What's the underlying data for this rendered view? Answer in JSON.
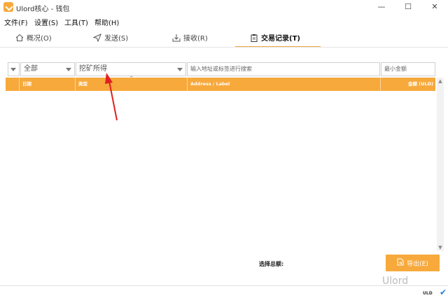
{
  "window": {
    "title": "Ulord核心 - 钱包",
    "controls": {
      "minimize": "—",
      "maximize": "☐",
      "close": "✕"
    }
  },
  "menu": [
    "文件(F)",
    "设置(S)",
    "工具(T)",
    "帮助(H)"
  ],
  "tabs": [
    {
      "label": "概况(O)",
      "icon": "home-icon",
      "active": false
    },
    {
      "label": "发送(S)",
      "icon": "send-icon",
      "active": false
    },
    {
      "label": "接收(R)",
      "icon": "receive-icon",
      "active": false
    },
    {
      "label": "交易记录(T)",
      "icon": "clipboard-icon",
      "active": true
    }
  ],
  "filters": {
    "date": {
      "selected": "全部"
    },
    "type": {
      "selected": "挖矿所得"
    },
    "search": {
      "placeholder": "输入地址或标签进行搜索"
    },
    "min_amount": {
      "placeholder": "最小金额"
    }
  },
  "table": {
    "columns": [
      "日期",
      "类型",
      "Address / Label",
      "金额 (ULD)"
    ],
    "rows": []
  },
  "footer": {
    "selection_total_label": "选择总额:",
    "export_label": "导出(E)"
  },
  "watermark": "Ulord",
  "status": {
    "unit": "ULD"
  },
  "colors": {
    "accent": "#f7a93c",
    "arrow": "#e02020",
    "check": "#2a7fd4"
  }
}
